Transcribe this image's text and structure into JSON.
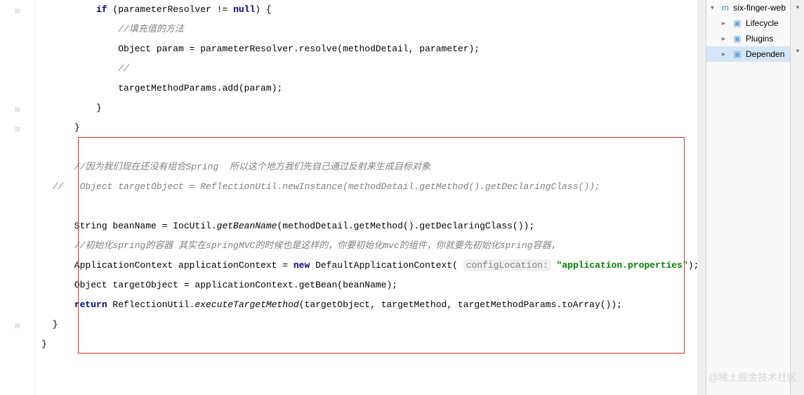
{
  "code": {
    "lines": [
      {
        "indent": "          ",
        "segments": [
          {
            "t": "kw",
            "v": "if"
          },
          {
            "t": "",
            "v": " (parameterResolver != "
          },
          {
            "t": "kw",
            "v": "null"
          },
          {
            "t": "",
            "v": ") {"
          }
        ]
      },
      {
        "indent": "              ",
        "segments": [
          {
            "t": "comment",
            "v": "//填充值的方法"
          }
        ]
      },
      {
        "indent": "              ",
        "segments": [
          {
            "t": "",
            "v": "Object param = parameterResolver.resolve(methodDetail, parameter);"
          }
        ]
      },
      {
        "indent": "              ",
        "segments": [
          {
            "t": "comment",
            "v": "//"
          }
        ]
      },
      {
        "indent": "              ",
        "segments": [
          {
            "t": "",
            "v": "targetMethodParams.add(param);"
          }
        ]
      },
      {
        "indent": "          ",
        "segments": [
          {
            "t": "brace",
            "v": "}"
          }
        ]
      },
      {
        "indent": "      ",
        "segments": [
          {
            "t": "brace",
            "v": "}"
          }
        ]
      },
      {
        "indent": "",
        "segments": []
      },
      {
        "indent": "      ",
        "segments": [
          {
            "t": "comment",
            "v": "//因为我们现在还没有组合Spring  所以这个地方我们先自己通过反射来生成目标对象"
          }
        ]
      },
      {
        "indent": "  ",
        "segments": [
          {
            "t": "comment",
            "v": "//   Object targetObject = ReflectionUtil.newInstance(methodDetail.getMethod().getDeclaringClass());"
          }
        ]
      },
      {
        "indent": "",
        "segments": []
      },
      {
        "indent": "      ",
        "segments": [
          {
            "t": "",
            "v": "String beanName = IocUtil."
          },
          {
            "t": "static",
            "v": "getBeanName"
          },
          {
            "t": "",
            "v": "(methodDetail.getMethod().getDeclaringClass());"
          }
        ]
      },
      {
        "indent": "      ",
        "segments": [
          {
            "t": "comment",
            "v": "//初始化spring的容器 其实在springMVC的时候也是这样的，你要初始化mvc的组件，你就要先初始化spring容器，"
          }
        ]
      },
      {
        "indent": "      ",
        "segments": [
          {
            "t": "",
            "v": "ApplicationContext applicationContext = "
          },
          {
            "t": "kw",
            "v": "new"
          },
          {
            "t": "",
            "v": " DefaultApplicationContext( "
          },
          {
            "t": "param-hint",
            "v": "configLocation:"
          },
          {
            "t": "",
            "v": " "
          },
          {
            "t": "str",
            "v": "\"application.properties\""
          },
          {
            "t": "",
            "v": ");"
          }
        ]
      },
      {
        "indent": "      ",
        "segments": [
          {
            "t": "",
            "v": "Object targetObject = applicationContext.getBean(beanName);"
          }
        ]
      },
      {
        "indent": "      ",
        "segments": [
          {
            "t": "kw",
            "v": "return"
          },
          {
            "t": "",
            "v": " ReflectionUtil."
          },
          {
            "t": "static",
            "v": "executeTargetMethod"
          },
          {
            "t": "",
            "v": "(targetObject, targetMethod, targetMethodParams.toArray());"
          }
        ]
      },
      {
        "indent": "  ",
        "segments": [
          {
            "t": "brace",
            "v": "}"
          }
        ]
      },
      {
        "indent": "",
        "segments": [
          {
            "t": "brace",
            "v": "}"
          }
        ]
      }
    ]
  },
  "sidebar": {
    "projectName": "six-finger-web",
    "items": [
      {
        "label": "Lifecycle",
        "selected": false
      },
      {
        "label": "Plugins",
        "selected": false
      },
      {
        "label": "Dependen",
        "selected": true
      }
    ]
  },
  "watermark": "@稀土掘金技术社区"
}
